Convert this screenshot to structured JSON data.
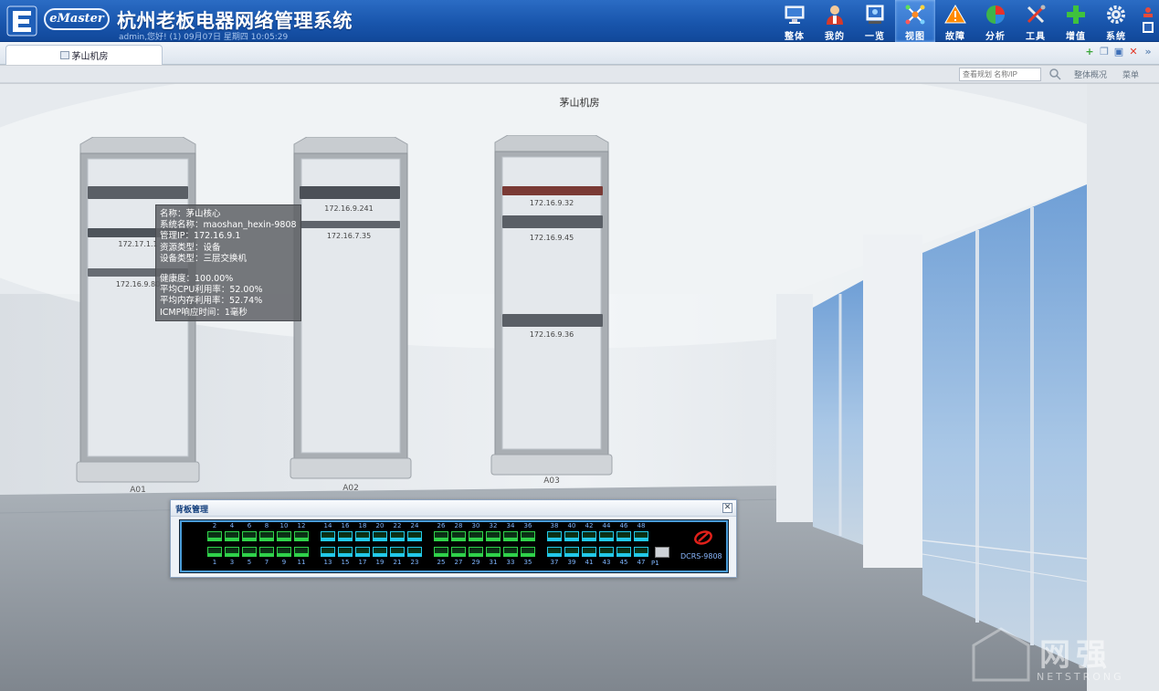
{
  "header": {
    "product": "eMaster",
    "title": "杭州老板电器网络管理系统",
    "subtitle": "admin,您好! (1) 09月07日 星期四 10:05:29",
    "nav": [
      {
        "label": "整体",
        "icon": "monitor-icon"
      },
      {
        "label": "我的",
        "icon": "user-icon"
      },
      {
        "label": "一览",
        "icon": "overview-screen-icon"
      },
      {
        "label": "视图",
        "icon": "topology-view-icon",
        "active": true
      },
      {
        "label": "故障",
        "icon": "warning-icon"
      },
      {
        "label": "分析",
        "icon": "pie-chart-icon"
      },
      {
        "label": "工具",
        "icon": "tools-icon"
      },
      {
        "label": "增值",
        "icon": "plus-icon"
      },
      {
        "label": "系统",
        "icon": "gear-icon"
      }
    ]
  },
  "tabs": [
    {
      "label": "茅山机房"
    }
  ],
  "toolbar": {
    "search_placeholder": "查看规划 名称/IP",
    "overview_link": "整体概况",
    "menu_link": "菜单"
  },
  "room": {
    "title": "茅山机房",
    "racks": [
      {
        "label": "A01",
        "devices": [
          {
            "ip": ""
          },
          {
            "ip": "172.17.1.1"
          },
          {
            "ip": "172.16.9.80"
          }
        ]
      },
      {
        "label": "A02",
        "devices": [
          {
            "ip": "172.16.9.241"
          },
          {
            "ip": "172.16.7.35"
          }
        ]
      },
      {
        "label": "A03",
        "devices": [
          {
            "ip": "172.16.9.32"
          },
          {
            "ip": "172.16.9.45"
          },
          {
            "ip": "172.16.9.36"
          }
        ]
      }
    ]
  },
  "tooltip": {
    "name": "名称：茅山核心",
    "sys_name": "系统名称：maoshan_hexin-9808",
    "mgmt_ip": "管理IP：172.16.9.1",
    "res_type": "资源类型：设备",
    "dev_type": "设备类型：三层交换机",
    "health": "健康度：100.00%",
    "cpu": "平均CPU利用率：52.00%",
    "mem": "平均内存利用率：52.74%",
    "icmp": "ICMP响应时间：1毫秒"
  },
  "backplane": {
    "title": "背板管理",
    "model": "DCRS-9808",
    "sfp_label": "P1",
    "port_groups": [
      {
        "top": [
          "2",
          "4",
          "6",
          "8",
          "10",
          "12"
        ],
        "bottom": [
          "1",
          "3",
          "5",
          "7",
          "9",
          "11"
        ]
      },
      {
        "top": [
          "14",
          "16",
          "18",
          "20",
          "22",
          "24"
        ],
        "bottom": [
          "13",
          "15",
          "17",
          "19",
          "21",
          "23"
        ]
      },
      {
        "top": [
          "26",
          "28",
          "30",
          "32",
          "34",
          "36"
        ],
        "bottom": [
          "25",
          "27",
          "29",
          "31",
          "33",
          "35"
        ]
      },
      {
        "top": [
          "38",
          "40",
          "42",
          "44",
          "46",
          "48"
        ],
        "bottom": [
          "37",
          "39",
          "41",
          "43",
          "45",
          "47"
        ]
      }
    ],
    "group_colors": [
      "#2fd14a",
      "#22c8e8",
      "#2fd14a",
      "#22c8e8"
    ]
  },
  "watermark": {
    "text": "网强",
    "sub": "NETSTRONG"
  }
}
